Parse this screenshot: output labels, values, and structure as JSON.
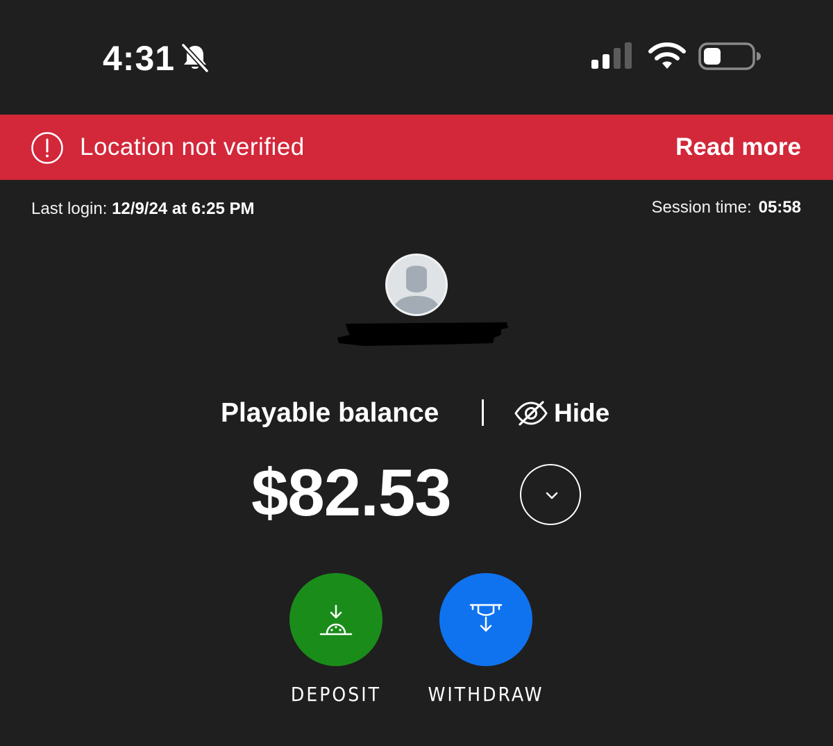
{
  "status_bar": {
    "time": "4:31",
    "icons": [
      "bell-slash-icon",
      "cellular-signal-icon",
      "wifi-icon",
      "battery-icon"
    ]
  },
  "alert": {
    "icon": "exclamation-circle-icon",
    "message": "Location not verified",
    "link_label": "Read more",
    "color": "#d3273a"
  },
  "info": {
    "last_login_label": "Last login:",
    "last_login_value": "12/9/24 at 6:25 PM",
    "session_label": "Session time:",
    "session_value": "05:58"
  },
  "profile": {
    "avatar_icon": "user-silhouette-icon"
  },
  "balance": {
    "label": "Playable balance",
    "hide_label": "Hide",
    "hide_icon": "eye-slash-icon",
    "amount": "$82.53",
    "expand_icon": "chevron-down-icon"
  },
  "actions": {
    "deposit": {
      "label": "DEPOSIT",
      "icon": "deposit-icon",
      "color": "#1a8c1a"
    },
    "withdraw": {
      "label": "WITHDRAW",
      "icon": "withdraw-icon",
      "color": "#0f73f0"
    }
  }
}
